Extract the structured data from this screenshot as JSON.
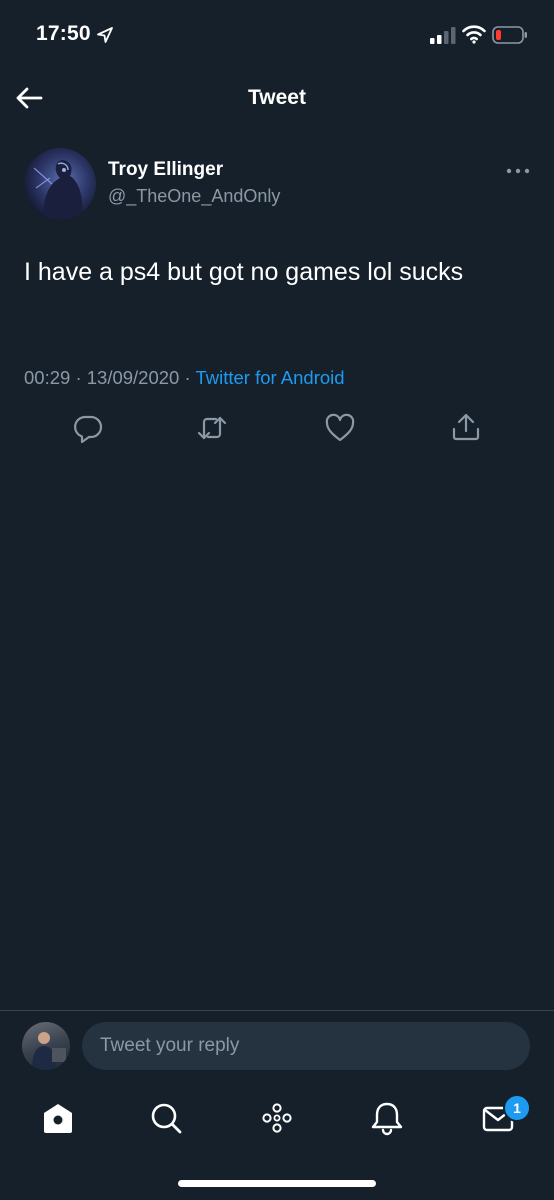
{
  "status_bar": {
    "time": "17:50",
    "battery_color": "#ff3b30"
  },
  "header": {
    "title": "Tweet"
  },
  "tweet": {
    "display_name": "Troy Ellinger",
    "handle": "@_TheOne_AndOnly",
    "text": "I have a ps4 but got no games lol sucks",
    "time": "00:29",
    "separator": "·",
    "date": "13/09/2020",
    "source": "Twitter for Android",
    "actions": [
      "reply-icon",
      "retweet-icon",
      "like-icon",
      "share-icon"
    ]
  },
  "reply": {
    "placeholder": "Tweet your reply"
  },
  "tab_bar": {
    "items": [
      "home-icon",
      "search-icon",
      "spaces-icon",
      "notifications-icon",
      "messages-icon"
    ],
    "messages_badge": "1"
  },
  "colors": {
    "background": "#15202b",
    "accent": "#1d9bf0",
    "secondary_text": "#8b98a5"
  }
}
